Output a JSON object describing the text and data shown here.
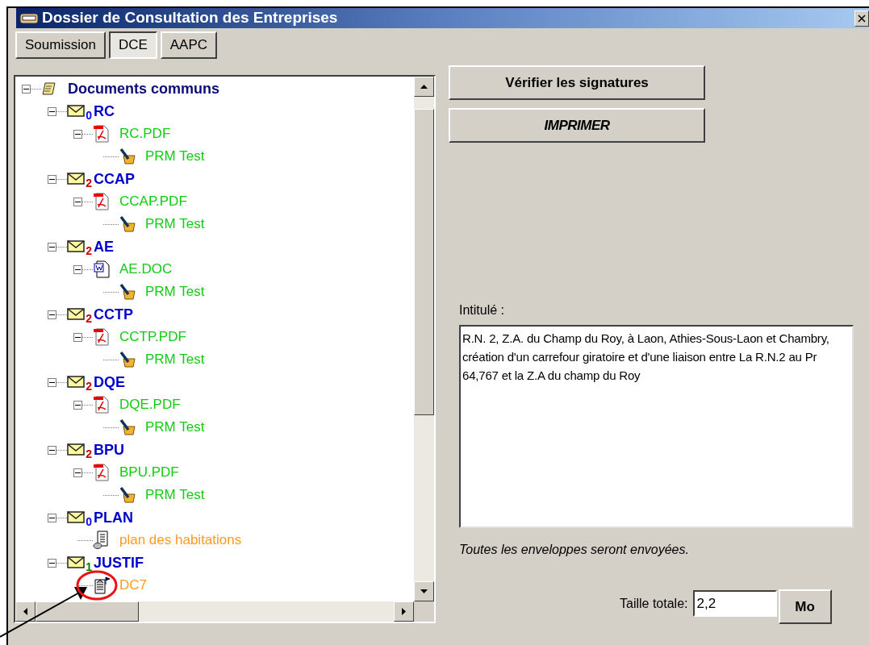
{
  "window": {
    "title": "Dossier de Consultation des Entreprises"
  },
  "tabs": [
    {
      "label": "Soumission",
      "selected": false
    },
    {
      "label": "DCE",
      "selected": true
    },
    {
      "label": "AAPC",
      "selected": false
    }
  ],
  "tree": {
    "nodes": [
      {
        "kind": "root",
        "label": "Documents communs",
        "expanded": true,
        "children": [
          {
            "kind": "envelope",
            "label": "RC",
            "badge": {
              "text": "0",
              "color": "#0000ff"
            },
            "expanded": true,
            "children": [
              {
                "kind": "pdf",
                "label": "RC.PDF",
                "color": "#11cc11",
                "expanded": true,
                "children": [
                  {
                    "kind": "signature",
                    "label": "PRM Test",
                    "color": "#11cc11"
                  }
                ]
              }
            ]
          },
          {
            "kind": "envelope",
            "label": "CCAP",
            "badge": {
              "text": "2",
              "color": "#cc0000"
            },
            "expanded": true,
            "children": [
              {
                "kind": "pdf",
                "label": "CCAP.PDF",
                "color": "#11cc11",
                "expanded": true,
                "children": [
                  {
                    "kind": "signature",
                    "label": "PRM Test",
                    "color": "#11cc11"
                  }
                ]
              }
            ]
          },
          {
            "kind": "envelope",
            "label": "AE",
            "badge": {
              "text": "2",
              "color": "#cc0000"
            },
            "expanded": true,
            "children": [
              {
                "kind": "doc",
                "label": "AE.DOC",
                "color": "#11cc11",
                "expanded": true,
                "children": [
                  {
                    "kind": "signature",
                    "label": "PRM Test",
                    "color": "#11cc11"
                  }
                ]
              }
            ]
          },
          {
            "kind": "envelope",
            "label": "CCTP",
            "badge": {
              "text": "2",
              "color": "#cc0000"
            },
            "expanded": true,
            "children": [
              {
                "kind": "pdf",
                "label": "CCTP.PDF",
                "color": "#11cc11",
                "expanded": true,
                "children": [
                  {
                    "kind": "signature",
                    "label": "PRM Test",
                    "color": "#11cc11"
                  }
                ]
              }
            ]
          },
          {
            "kind": "envelope",
            "label": "DQE",
            "badge": {
              "text": "2",
              "color": "#cc0000"
            },
            "expanded": true,
            "children": [
              {
                "kind": "pdf",
                "label": "DQE.PDF",
                "color": "#11cc11",
                "expanded": true,
                "children": [
                  {
                    "kind": "signature",
                    "label": "PRM Test",
                    "color": "#11cc11"
                  }
                ]
              }
            ]
          },
          {
            "kind": "envelope",
            "label": "BPU",
            "badge": {
              "text": "2",
              "color": "#cc0000"
            },
            "expanded": true,
            "children": [
              {
                "kind": "pdf",
                "label": "BPU.PDF",
                "color": "#11cc11",
                "expanded": true,
                "children": [
                  {
                    "kind": "signature",
                    "label": "PRM Test",
                    "color": "#11cc11"
                  }
                ]
              }
            ]
          },
          {
            "kind": "envelope",
            "label": "PLAN",
            "badge": {
              "text": "0",
              "color": "#0000ff"
            },
            "expanded": true,
            "children": [
              {
                "kind": "attachment",
                "label": "plan des habitations",
                "color": "#ff9922"
              }
            ]
          },
          {
            "kind": "envelope",
            "label": "JUSTIF",
            "badge": {
              "text": "1",
              "color": "#008000"
            },
            "expanded": true,
            "children": [
              {
                "kind": "form",
                "label": "DC7",
                "color": "#ff9922"
              }
            ]
          }
        ]
      }
    ]
  },
  "buttons": [
    {
      "label": "Vérifier les signatures",
      "kind": "bold"
    },
    {
      "label": "IMPRIMER",
      "kind": "italic"
    }
  ],
  "intitule": {
    "label": "Intitulé :",
    "value": "R.N. 2, Z.A. du Champ du Roy, à Laon, Athies-Sous-Laon et Chambry, création d'un carrefour giratoire et d'une liaison entre La R.N.2 au Pr 64,767 et la Z.A du champ du Roy"
  },
  "note": "Toutes les enveloppes seront envoyées.",
  "size": {
    "label": "Taille totale:",
    "value": "2,2",
    "unit": "Mo"
  }
}
